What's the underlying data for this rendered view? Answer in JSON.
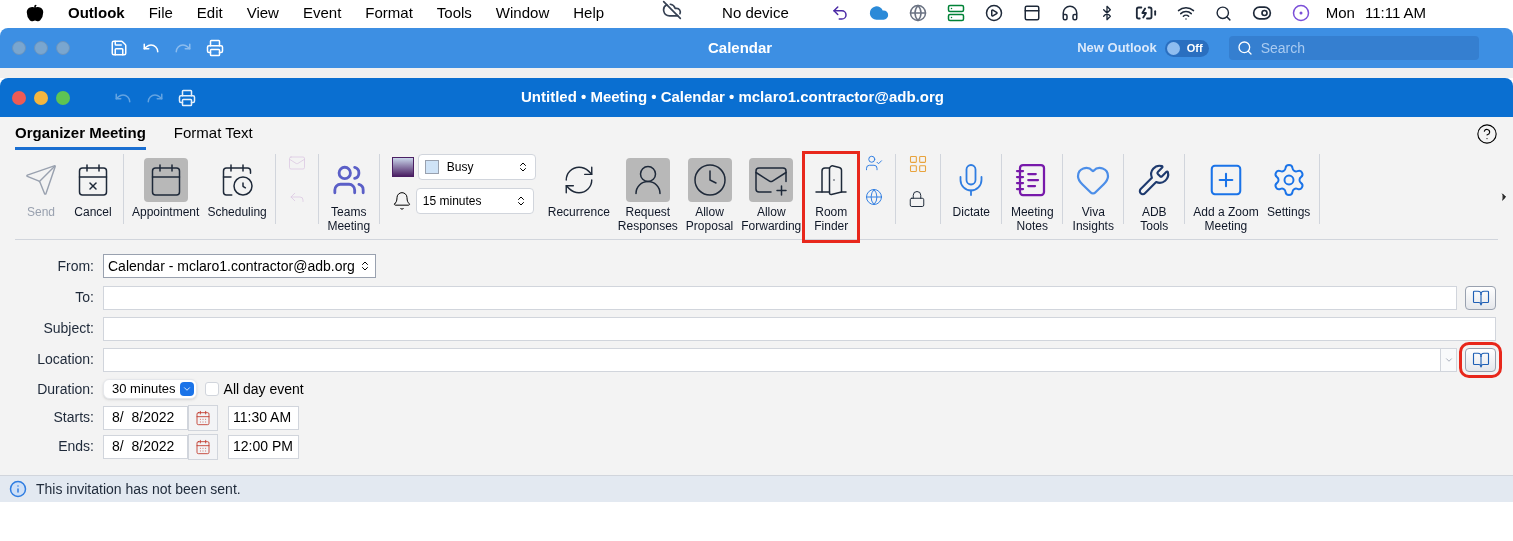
{
  "menu_bar": {
    "app": "Outlook",
    "items": [
      "File",
      "Edit",
      "View",
      "Event",
      "Format",
      "Tools",
      "Window",
      "Help"
    ],
    "status": "No device",
    "day": "Mon",
    "time": "11:11 AM"
  },
  "background_window": {
    "title": "Calendar",
    "new_outlook": {
      "label": "New Outlook",
      "toggle_label": "Off",
      "on": false
    },
    "search": {
      "placeholder": "Search"
    }
  },
  "window": {
    "title": "Untitled • Meeting • Calendar • mclaro1.contractor@adb.org"
  },
  "tabs": [
    {
      "label": "Organizer Meeting",
      "selected": true
    },
    {
      "label": "Format Text",
      "selected": false
    }
  ],
  "ribbon": [
    {
      "kind": "button",
      "label": "Send",
      "disabled": true,
      "on": false,
      "highlighted": false
    },
    {
      "kind": "button",
      "label": "Cancel",
      "disabled": false,
      "on": false,
      "highlighted": false
    },
    {
      "kind": "divider"
    },
    {
      "kind": "button",
      "label": "Appointment",
      "disabled": false,
      "on": true,
      "highlighted": false
    },
    {
      "kind": "button",
      "label": "Scheduling",
      "disabled": false,
      "on": false,
      "highlighted": false
    },
    {
      "kind": "divider"
    },
    {
      "kind": "icon-pair",
      "disabled": true
    },
    {
      "kind": "divider"
    },
    {
      "kind": "button",
      "label": "Teams\nMeeting",
      "disabled": false,
      "on": false,
      "highlighted": false
    },
    {
      "kind": "divider"
    },
    {
      "kind": "selects",
      "show_as": "Busy",
      "reminder": "15 minutes"
    },
    {
      "kind": "button",
      "label": "Recurrence",
      "disabled": false,
      "on": false,
      "highlighted": false
    },
    {
      "kind": "button",
      "label": "Request\nResponses",
      "disabled": false,
      "on": true,
      "highlighted": false
    },
    {
      "kind": "button",
      "label": "Allow\nProposal",
      "disabled": false,
      "on": true,
      "highlighted": false
    },
    {
      "kind": "button",
      "label": "Allow\nForwarding",
      "disabled": false,
      "on": true,
      "highlighted": false
    },
    {
      "kind": "button",
      "label": "Room\nFinder",
      "disabled": false,
      "on": false,
      "highlighted": true
    },
    {
      "kind": "icon-pair",
      "disabled": false
    },
    {
      "kind": "divider"
    },
    {
      "kind": "icon-pair",
      "disabled": false
    },
    {
      "kind": "divider"
    },
    {
      "kind": "button",
      "label": "Dictate",
      "disabled": false,
      "on": false,
      "highlighted": false
    },
    {
      "kind": "divider"
    },
    {
      "kind": "button",
      "label": "Meeting\nNotes",
      "disabled": false,
      "on": false,
      "highlighted": false
    },
    {
      "kind": "divider"
    },
    {
      "kind": "button",
      "label": "Viva\nInsights",
      "disabled": false,
      "on": false,
      "highlighted": false
    },
    {
      "kind": "divider"
    },
    {
      "kind": "button",
      "label": "ADB\nTools",
      "disabled": false,
      "on": false,
      "highlighted": false
    },
    {
      "kind": "divider"
    },
    {
      "kind": "button",
      "label": "Add a Zoom\nMeeting",
      "disabled": false,
      "on": false,
      "highlighted": false
    },
    {
      "kind": "button",
      "label": "Settings",
      "disabled": false,
      "on": false,
      "highlighted": false
    },
    {
      "kind": "divider"
    }
  ],
  "form": {
    "from": {
      "label": "From:",
      "value": "Calendar - mclaro1.contractor@adb.org"
    },
    "to": {
      "label": "To:",
      "address_book_highlighted": false
    },
    "subject": {
      "label": "Subject:"
    },
    "location": {
      "label": "Location:",
      "address_book_highlighted": true
    },
    "duration": {
      "label": "Duration:",
      "value": "30 minutes"
    },
    "all_day": {
      "label": "All day event",
      "checked": false
    },
    "starts": {
      "label": "Starts:",
      "date": "8/  8/2022",
      "time": "11:30 AM"
    },
    "ends": {
      "label": "Ends:",
      "date": "8/  8/2022",
      "time": "12:00 PM"
    }
  },
  "info_bar": {
    "text": "This invitation has not been sent."
  }
}
